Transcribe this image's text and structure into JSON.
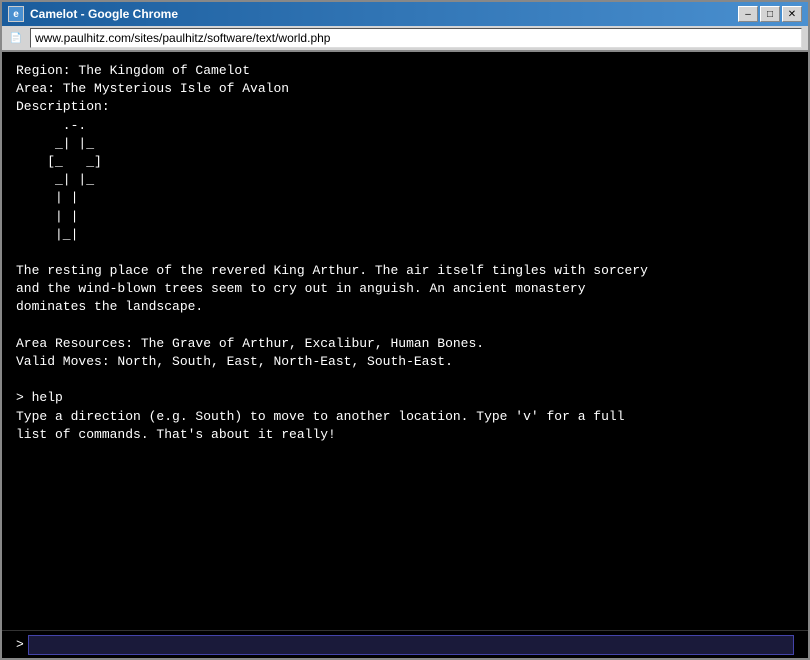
{
  "window": {
    "title": "Camelot - Google Chrome",
    "title_icon": "🌐",
    "controls": {
      "minimize": "–",
      "maximize": "□",
      "close": "✕"
    }
  },
  "browser": {
    "address_icon": "📄",
    "url": "www.paulhitz.com/sites/paulhitz/software/text/world.php"
  },
  "terminal": {
    "region_line": "Region: The Kingdom of Camelot",
    "area_line": "Area: The Mysterious Isle of Avalon",
    "description_label": "Description:",
    "ascii_art": "     .-.\n    _| |_\n   [ _ _ ]\n    _| |_\n    | |\n    | |\n    |_|",
    "description_text": "The resting place of the revered King Arthur. The air itself tingles with sorcery\nand the wind-blown trees seem to cry out in anguish. An ancient monastery\ndominates the landscape.",
    "resources_line": "Area Resources: The Grave of Arthur, Excalibur, Human Bones.",
    "moves_line": "Valid Moves: North, South, East, North-East, South-East.",
    "command_prompt": "> help",
    "help_text": "Type a direction (e.g. South) to move to another location. Type 'v' for a full\nlist of commands. That's about it really!",
    "prompt_symbol": ">"
  }
}
